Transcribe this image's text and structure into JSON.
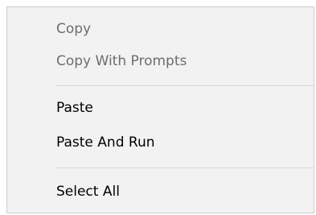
{
  "context_menu": {
    "items": [
      {
        "label": "Copy",
        "enabled": false
      },
      {
        "label": "Copy With Prompts",
        "enabled": false
      },
      {
        "label": "Paste",
        "enabled": true
      },
      {
        "label": "Paste And Run",
        "enabled": true
      },
      {
        "label": "Select All",
        "enabled": true
      }
    ]
  },
  "colors": {
    "menu_background": "#f2f2f2",
    "menu_border": "#cccccc",
    "disabled_text": "#6d6d6d",
    "enabled_text": "#000000",
    "separator": "#d7d7d7"
  }
}
